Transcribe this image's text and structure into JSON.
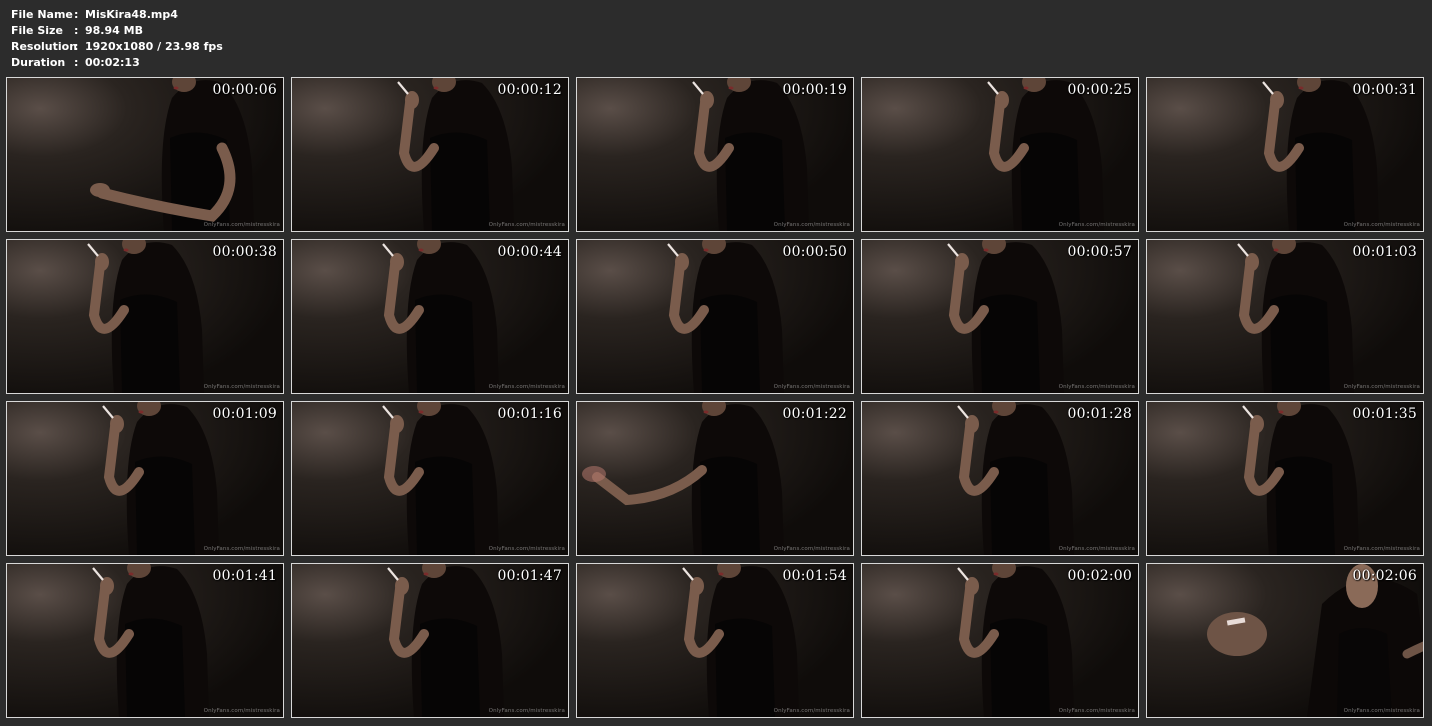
{
  "info": {
    "rows": [
      {
        "label": "File Name",
        "colon": ":",
        "value": "MisKira48.mp4"
      },
      {
        "label": "File Size",
        "colon": ":",
        "value": "98.94 MB"
      },
      {
        "label": "Resolution",
        "colon": ":",
        "value": "1920x1080 / 23.98 fps"
      },
      {
        "label": "Duration",
        "colon": ":",
        "value": "00:02:13"
      }
    ]
  },
  "frames": [
    {
      "time": "00:00:06",
      "watermark": "OnlyFans.com/mistresskira"
    },
    {
      "time": "00:00:12",
      "watermark": "OnlyFans.com/mistresskira"
    },
    {
      "time": "00:00:19",
      "watermark": "OnlyFans.com/mistresskira"
    },
    {
      "time": "00:00:25",
      "watermark": "OnlyFans.com/mistresskira"
    },
    {
      "time": "00:00:31",
      "watermark": "OnlyFans.com/mistresskira"
    },
    {
      "time": "00:00:38",
      "watermark": "OnlyFans.com/mistresskira"
    },
    {
      "time": "00:00:44",
      "watermark": "OnlyFans.com/mistresskira"
    },
    {
      "time": "00:00:50",
      "watermark": "OnlyFans.com/mistresskira"
    },
    {
      "time": "00:00:57",
      "watermark": "OnlyFans.com/mistresskira"
    },
    {
      "time": "00:01:03",
      "watermark": "OnlyFans.com/mistresskira"
    },
    {
      "time": "00:01:09",
      "watermark": "OnlyFans.com/mistresskira"
    },
    {
      "time": "00:01:16",
      "watermark": "OnlyFans.com/mistresskira"
    },
    {
      "time": "00:01:22",
      "watermark": "OnlyFans.com/mistresskira"
    },
    {
      "time": "00:01:28",
      "watermark": "OnlyFans.com/mistresskira"
    },
    {
      "time": "00:01:35",
      "watermark": "OnlyFans.com/mistresskira"
    },
    {
      "time": "00:01:41",
      "watermark": "OnlyFans.com/mistresskira"
    },
    {
      "time": "00:01:47",
      "watermark": "OnlyFans.com/mistresskira"
    },
    {
      "time": "00:01:54",
      "watermark": "OnlyFans.com/mistresskira"
    },
    {
      "time": "00:02:00",
      "watermark": "OnlyFans.com/mistresskira"
    },
    {
      "time": "00:02:06",
      "watermark": "OnlyFans.com/mistresskira"
    }
  ],
  "colors": {
    "page_background": "#2c2c2c",
    "info_text": "#ffffff",
    "thumb_border": "#d8d8d8",
    "timestamp_text": "#ffffff"
  }
}
